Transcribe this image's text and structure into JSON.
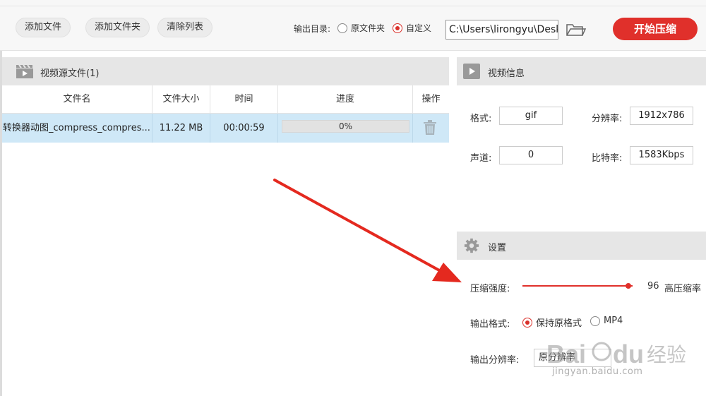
{
  "toolbar": {
    "add_file": "添加文件",
    "add_folder": "添加文件夹",
    "clear_list": "清除列表",
    "output_dir_label": "输出目录:",
    "radio_original": "原文件夹",
    "radio_custom": "自定义",
    "output_path": "C:\\Users\\lirongyu\\Desk",
    "start": "开始压缩"
  },
  "source": {
    "title": "视频源文件(1)",
    "columns": [
      "文件名",
      "文件大小",
      "时间",
      "进度",
      "操作"
    ],
    "rows": [
      {
        "name": "转换器动图_compress_compres...",
        "size": "11.22 MB",
        "duration": "00:00:59",
        "progress_text": "0%",
        "progress": 0
      }
    ]
  },
  "video_info": {
    "title": "视频信息",
    "format_label": "格式:",
    "format_value": "gif",
    "resolution_label": "分辨率:",
    "resolution_value": "1912x786",
    "channels_label": "声道:",
    "channels_value": "0",
    "bitrate_label": "比特率:",
    "bitrate_value": "1583Kbps"
  },
  "settings": {
    "title": "设置",
    "strength_label": "压缩强度:",
    "strength_value": "96",
    "strength_max": 100,
    "strength_tag": "高压缩率",
    "format_label": "输出格式:",
    "format_keep": "保持原格式",
    "format_mp4": "MP4",
    "resolution_label": "输出分辨率:",
    "resolution_value": "原分辨率"
  },
  "watermark": {
    "brand": "Baidu经验",
    "url": "jingyan.baidu.com"
  },
  "colors": {
    "accent": "#e0302b",
    "row_selected": "#cfe8f7",
    "header_bg": "#e6e6e6"
  }
}
